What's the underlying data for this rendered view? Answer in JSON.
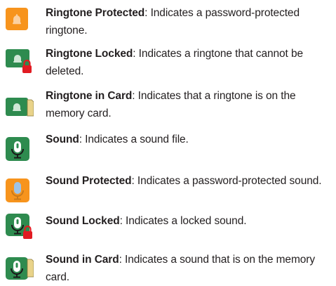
{
  "entries": [
    {
      "icon": "ringtone-protected-icon",
      "term": "Ringtone Protected",
      "desc": ": Indicates a password-protected ringtone."
    },
    {
      "icon": "ringtone-locked-icon",
      "term": "Ringtone Locked",
      "desc": ": Indicates a ringtone that cannot be deleted."
    },
    {
      "icon": "ringtone-in-card-icon",
      "term": "Ringtone in Card",
      "desc": ": Indicates that a ringtone is on the memory card."
    },
    {
      "icon": "sound-icon",
      "term": "Sound",
      "desc": ": Indicates a sound file."
    },
    {
      "icon": "sound-protected-icon",
      "term": "Sound Protected",
      "desc": ": Indicates a password-protected sound."
    },
    {
      "icon": "sound-locked-icon",
      "term": "Sound Locked",
      "desc": ": Indicates a locked sound."
    },
    {
      "icon": "sound-in-card-icon",
      "term": "Sound in Card",
      "desc": ": Indicates a sound that is on the memory card."
    }
  ],
  "colors": {
    "green": "#2e8b4f",
    "orange": "#f7941d",
    "lock_red": "#e11b22",
    "card_yellow": "#e9d38a"
  }
}
